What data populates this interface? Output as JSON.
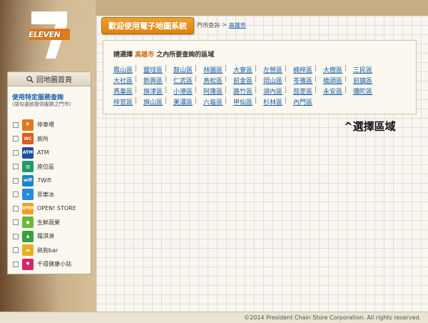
{
  "brand": {
    "name": "ELEVEN",
    "numeral": "7"
  },
  "banner": {
    "title": "歡迎使用電子地圖系統"
  },
  "breadcrumb": {
    "crumb1": "門市查詢",
    "sep": ">",
    "crumb2": "高雄市"
  },
  "district": {
    "prompt_before": "請選擇 ",
    "city": "高雄市",
    "prompt_after": " 之內所要查詢的區域",
    "separator": "|",
    "items": [
      "鳳山區",
      "鹽埕區",
      "鼓山區",
      "林園區",
      "大寮區",
      "左營區",
      "楠梓區",
      "大樹區",
      "三民區",
      "大社區",
      "新興區",
      "仁武區",
      "鳥松區",
      "前金區",
      "岡山區",
      "苓雅區",
      "橋頭區",
      "前鎮區",
      "燕巢區",
      "旗津區",
      "小港區",
      "阿蓮區",
      "路竹區",
      "湖內區",
      "茄萣區",
      "永安區",
      "彌陀區",
      "梓官區",
      "旗山區",
      "美濃區",
      "六龜區",
      "甲仙區",
      "杉林區",
      "內門區"
    ]
  },
  "annotation": {
    "text": "^選擇區域"
  },
  "nav": {
    "home_label": "回地圖首頁",
    "filter_title": "使用特定服務查詢",
    "filter_sub": "(請勾選欲提供服務之門市)",
    "filters": [
      {
        "label": "停車場",
        "icon_text": "P",
        "color": "#e07a1a"
      },
      {
        "label": "廁所",
        "icon_text": "WC",
        "color": "#e25a1c"
      },
      {
        "label": "ATM",
        "icon_text": "ATM",
        "color": "#1c4fa0"
      },
      {
        "label": "座位區",
        "icon_text": "▥",
        "color": "#1e9a6a"
      },
      {
        "label": "7Wifi",
        "icon_text": "wifi",
        "color": "#1a86c8"
      },
      {
        "label": "思樂冰",
        "icon_text": "▾",
        "color": "#2a8ad6"
      },
      {
        "label": "OPEN! STORE",
        "icon_text": "OPEN",
        "color": "#f0a020"
      },
      {
        "label": "生鮮蔬果",
        "icon_text": "●",
        "color": "#6ab83a"
      },
      {
        "label": "霜淇淋",
        "icon_text": "▲",
        "color": "#3aa040"
      },
      {
        "label": "熱狗bar",
        "icon_text": "▬",
        "color": "#e8b020"
      },
      {
        "label": "千禧健康小站",
        "icon_text": "♥",
        "color": "#d02a6a"
      }
    ]
  },
  "footer": {
    "copyright": "©2014 President Chain Store Corporation.   All rights reserved."
  }
}
